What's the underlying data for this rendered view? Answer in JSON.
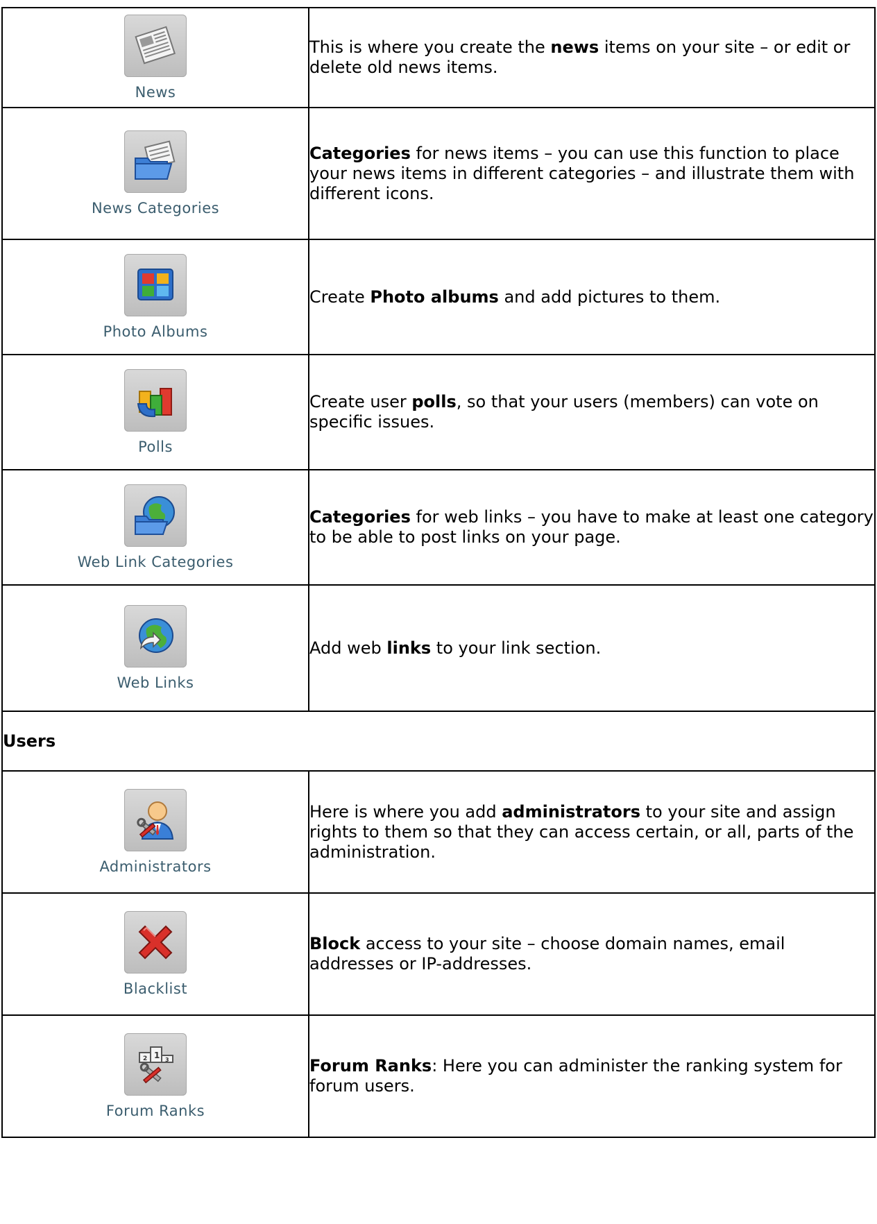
{
  "rows": [
    {
      "icon_label": "News",
      "icon_name": "newspaper-icon",
      "desc": {
        "before": "This is where you create the ",
        "bold": "news",
        "after": " items on your site – or edit or delete old news items."
      }
    },
    {
      "icon_label": "News Categories",
      "icon_name": "news-folder-icon",
      "desc": {
        "before": "",
        "bold": "Categories",
        "after": " for news items – you can use this function to place your news items in different categories – and illustrate them with different icons."
      }
    },
    {
      "icon_label": "Photo Albums",
      "icon_name": "photo-album-icon",
      "desc": {
        "before": "Create ",
        "bold": "Photo albums",
        "after": " and add pictures to them."
      }
    },
    {
      "icon_label": "Polls",
      "icon_name": "poll-chart-icon",
      "desc": {
        "before": "Create user ",
        "bold": "polls",
        "after": ", so that your users (members) can vote on specific issues."
      }
    },
    {
      "icon_label": "Web Link Categories",
      "icon_name": "globe-folder-icon",
      "desc": {
        "before": "",
        "bold": "Categories",
        "after": " for web links – you have to make at least one category to be able to post links on your page."
      }
    },
    {
      "icon_label": "Web Links",
      "icon_name": "globe-link-icon",
      "desc": {
        "before": "Add web ",
        "bold": "links",
        "after": " to your link section."
      }
    }
  ],
  "section": {
    "title": "Users"
  },
  "user_rows": [
    {
      "icon_label": "Administrators",
      "icon_name": "admin-user-icon",
      "desc": {
        "before": "Here is where you add ",
        "bold": "administrators",
        "after": " to your site and assign rights to them so that they can access certain, or all, parts of the administration."
      }
    },
    {
      "icon_label": "Blacklist",
      "icon_name": "red-x-icon",
      "desc": {
        "before": "",
        "bold": "Block",
        "after": " access to your site – choose domain names, email addresses or IP-addresses."
      }
    },
    {
      "icon_label": "Forum Ranks",
      "icon_name": "podium-tools-icon",
      "desc": {
        "before": "",
        "bold": "Forum Ranks",
        "after": ": Here you can administer the ranking system for forum users."
      }
    }
  ]
}
